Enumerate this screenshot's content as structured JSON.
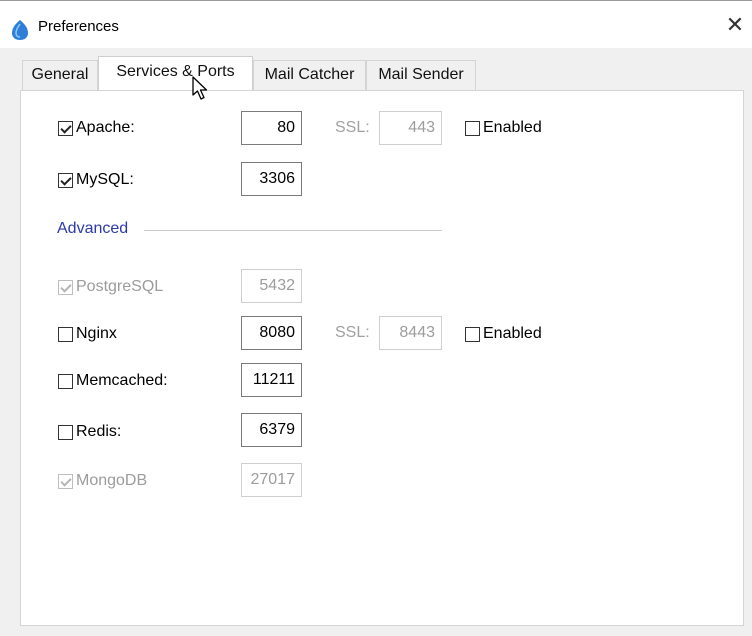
{
  "window": {
    "title": "Preferences",
    "close_symbol": "✕",
    "app_icon": "servbay-logo-icon"
  },
  "tabs": [
    {
      "label": "General",
      "active": false
    },
    {
      "label": "Services & Ports",
      "active": true
    },
    {
      "label": "Mail Catcher",
      "active": false
    },
    {
      "label": "Mail Sender",
      "active": false
    }
  ],
  "services": {
    "apache": {
      "label": "Apache:",
      "checked": true,
      "port": "80",
      "ssl_label": "SSL:",
      "ssl_port": "443",
      "ssl_enabled_label": "Enabled",
      "ssl_enabled": false
    },
    "mysql": {
      "label": "MySQL:",
      "checked": true,
      "port": "3306"
    }
  },
  "advanced": {
    "section_label": "Advanced",
    "postgresql": {
      "label": "PostgreSQL",
      "checked": true,
      "disabled": true,
      "port": "5432"
    },
    "nginx": {
      "label": "Nginx",
      "checked": false,
      "port": "8080",
      "ssl_label": "SSL:",
      "ssl_port": "8443",
      "ssl_enabled_label": "Enabled",
      "ssl_enabled": false
    },
    "memcached": {
      "label": "Memcached:",
      "checked": false,
      "port": "11211"
    },
    "redis": {
      "label": "Redis:",
      "checked": false,
      "port": "6379"
    },
    "mongodb": {
      "label": "MongoDB",
      "checked": true,
      "disabled": true,
      "port": "27017"
    }
  },
  "colors": {
    "section_accent": "#2b3aa8",
    "disabled_text": "#9c9c9c",
    "dialog_background": "#f0f0f0"
  }
}
